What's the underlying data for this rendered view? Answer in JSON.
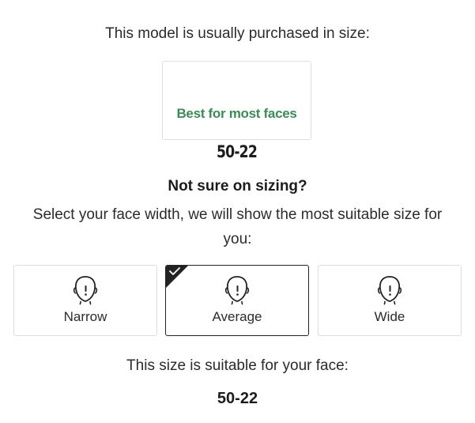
{
  "recommendation": {
    "intro": "This model is usually purchased in size:",
    "size": "50-22",
    "note": "Best for most faces",
    "note_color": "#3a8d55"
  },
  "sizing_help": {
    "title": "Not sure on sizing?",
    "instructions": "Select your face width, we will show the most suitable size for you:"
  },
  "face_width_options": [
    {
      "label": "Narrow",
      "icon": "face-icon",
      "selected": false
    },
    {
      "label": "Average",
      "icon": "face-icon",
      "selected": true
    },
    {
      "label": "Wide",
      "icon": "face-icon",
      "selected": false
    }
  ],
  "result": {
    "text": "This size is suitable for your face:",
    "size": "50-22"
  },
  "colors": {
    "selected_border": "#222222",
    "default_border": "#dcdcdc",
    "accent_green": "#3a8d55"
  }
}
